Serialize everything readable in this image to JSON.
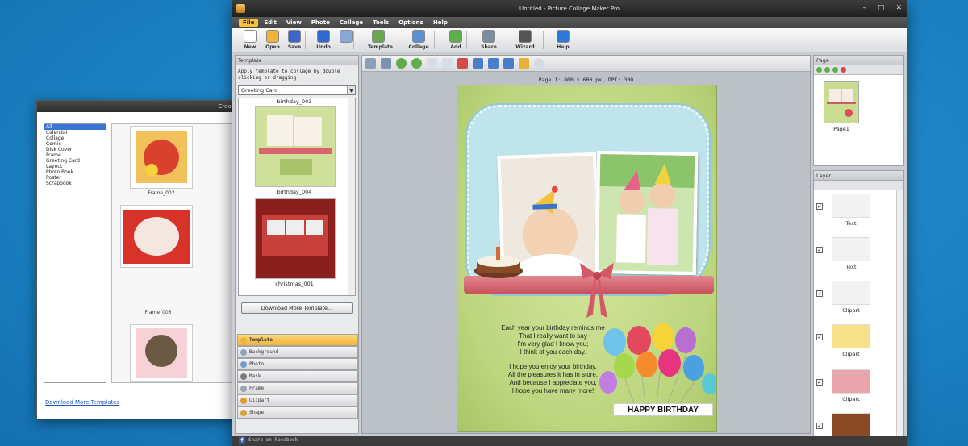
{
  "back_window": {
    "title": "Create From T",
    "categories": [
      "All",
      "Calendar",
      "Collage",
      "Comic",
      "Disk Cover",
      "Frame",
      "Greeting Card",
      "Layout",
      "Photo Book",
      "Poster",
      "Scrapbook"
    ],
    "thumbs": [
      "Frame_002",
      "Frame_003"
    ],
    "download_link": "Download More Templates"
  },
  "window": {
    "title": "Untitled - Picture Collage Maker Pro",
    "controls": [
      "–",
      "□",
      "✕"
    ]
  },
  "menu": [
    "File",
    "Edit",
    "View",
    "Photo",
    "Collage",
    "Tools",
    "Options",
    "Help"
  ],
  "toolbar": {
    "buttons": [
      {
        "label": "New",
        "icon": "new-icon",
        "color": "#ffffff"
      },
      {
        "label": "Open",
        "icon": "open-folder-icon",
        "color": "#f0b43c"
      },
      {
        "label": "Save",
        "icon": "save-icon",
        "color": "#3c66c8"
      },
      {
        "label": "Undo",
        "icon": "undo-icon",
        "color": "#2f6ad0"
      },
      {
        "label": "",
        "icon": "redo-icon",
        "color": "#8aa6d8"
      },
      {
        "label": "Template",
        "icon": "template-icon",
        "color": "#6aa84f"
      },
      {
        "label": "Collage",
        "icon": "collage-icon",
        "color": "#5b8fd6"
      },
      {
        "label": "Add",
        "icon": "add-icon",
        "color": "#5fae4b"
      },
      {
        "label": "Share",
        "icon": "share-icon",
        "color": "#7a8ea3"
      },
      {
        "label": "Wizard",
        "icon": "wizard-icon",
        "color": "#555555"
      },
      {
        "label": "Help",
        "icon": "help-icon",
        "color": "#2f78d8"
      }
    ]
  },
  "template_panel": {
    "header": "Template",
    "description": "Apply template to collage by double clicking or dragging",
    "category": "Greeting Card",
    "items": [
      "birthday_003",
      "birthday_004",
      "christmas_001"
    ],
    "download_button": "Download More Template...",
    "tabs": [
      {
        "label": "Template",
        "selected": true,
        "color": "#f0b43c"
      },
      {
        "label": "Background",
        "selected": false,
        "color": "#8fa3c0"
      },
      {
        "label": "Photo",
        "selected": false,
        "color": "#6e9bd4"
      },
      {
        "label": "Mask",
        "selected": false,
        "color": "#7a7a7a"
      },
      {
        "label": "Frame",
        "selected": false,
        "color": "#9aa4b4"
      },
      {
        "label": "Clipart",
        "selected": false,
        "color": "#e39a2c"
      },
      {
        "label": "Shape",
        "selected": false,
        "color": "#d9a237"
      }
    ]
  },
  "canvas": {
    "page_info": "Page 1: 800 x 600 px, DPI: 300",
    "poem": [
      "Each year your birthday reminds me",
      "That I really want to say",
      "I'm very glad I know you;",
      "I think of you each day.",
      "",
      "I hope you enjoy your birthday,",
      "All the pleasures it has in store,",
      "And because I appreciate you,",
      "I hope you have many more!"
    ],
    "banner": "HAPPY BIRTHDAY"
  },
  "pages_panel": {
    "header": "Page",
    "items": [
      "Page1"
    ]
  },
  "layers_panel": {
    "header": "Layer",
    "items": [
      "Text",
      "Text",
      "Clipart",
      "Clipart",
      "Clipart",
      ""
    ]
  },
  "status": "Share on Facebook"
}
